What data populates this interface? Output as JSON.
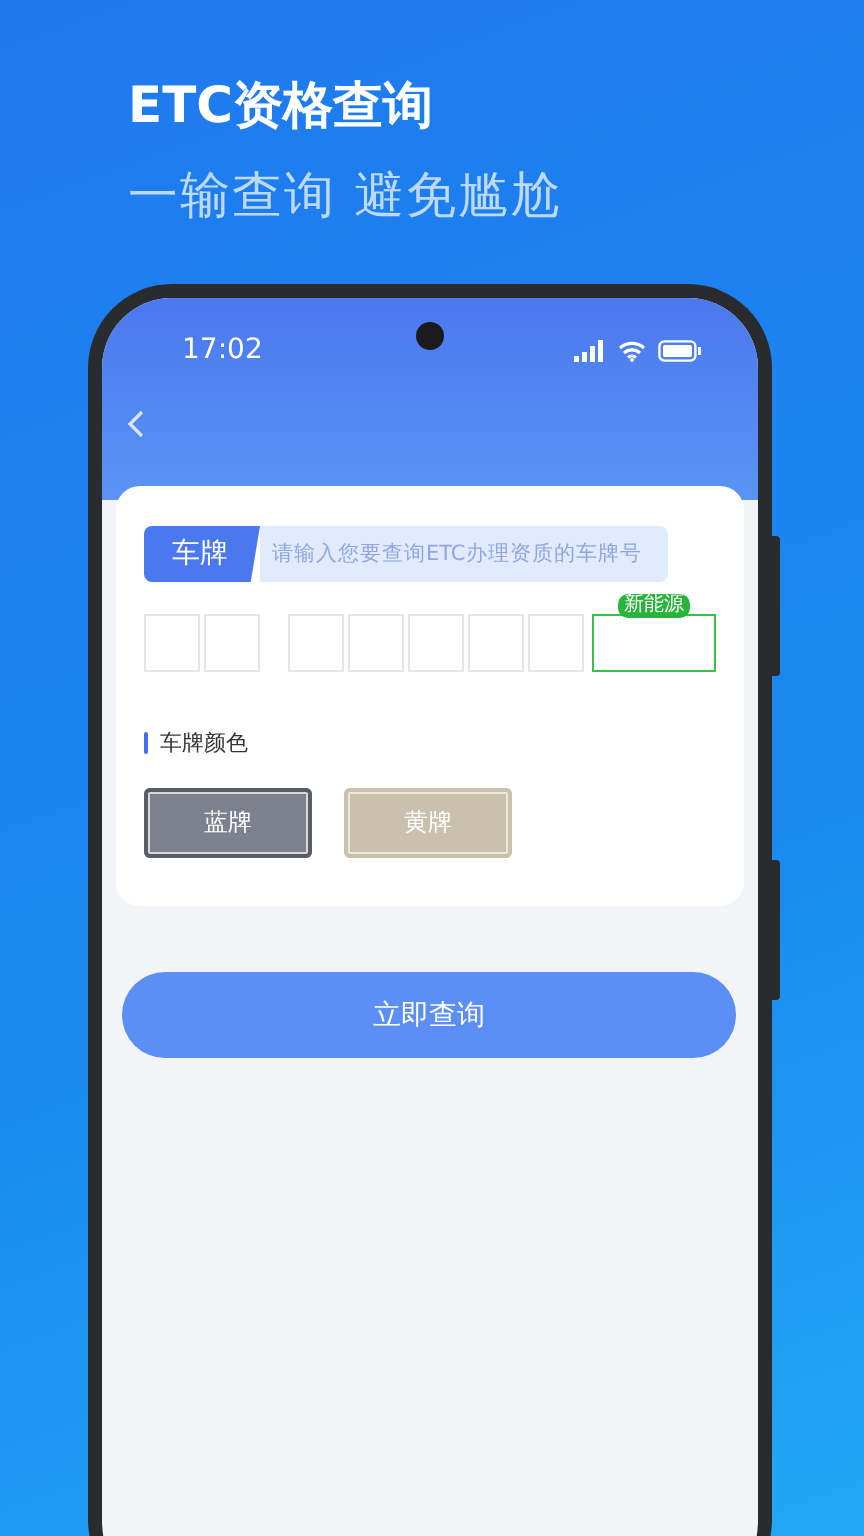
{
  "promo": {
    "title": "ETC资格查询",
    "subtitle": "一输查询 避免尴尬"
  },
  "status_bar": {
    "time": "17:02"
  },
  "plate_input": {
    "tag": "车牌",
    "placeholder": "请输入您要查询ETC办理资质的车牌号"
  },
  "plate_boxes": [
    {
      "kind": "normal"
    },
    {
      "kind": "normal"
    },
    {
      "kind": "normal"
    },
    {
      "kind": "normal"
    },
    {
      "kind": "normal"
    },
    {
      "kind": "normal"
    },
    {
      "kind": "normal"
    },
    {
      "kind": "new-energy",
      "badge": "新能源"
    }
  ],
  "plate_color": {
    "label": "车牌颜色",
    "options": [
      {
        "label": "蓝牌",
        "color": "#7d818e",
        "selected": true
      },
      {
        "label": "黄牌",
        "color": "#c9c1ab",
        "selected": false
      }
    ]
  },
  "query_button": "立即查询"
}
